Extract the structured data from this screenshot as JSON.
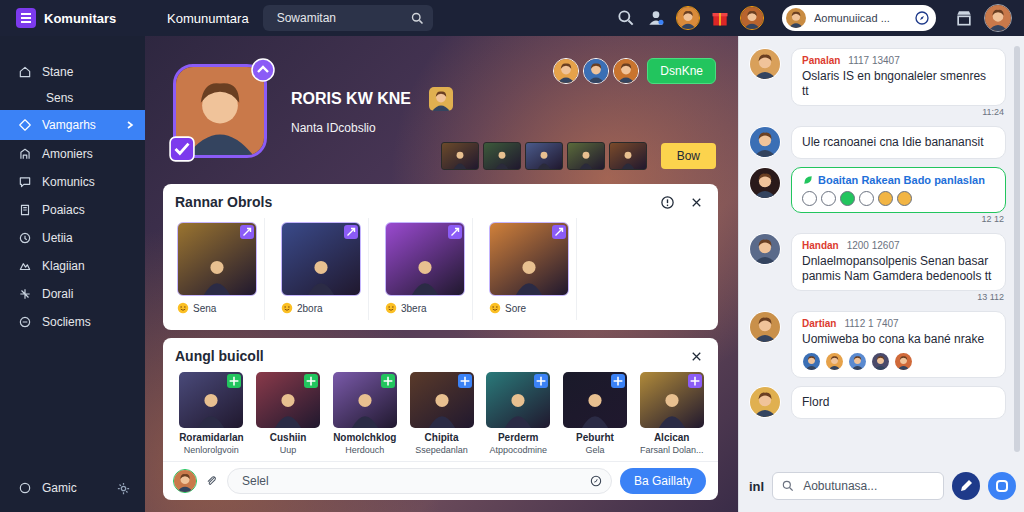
{
  "app": {
    "name": "Komunitars"
  },
  "topbar": {
    "title": "Komunumtara",
    "search": {
      "placeholder": "Sowamitan"
    },
    "community_search": {
      "placeholder": "Aomunuiicad ..."
    },
    "avatars": [
      {
        "color": "#d98a3a"
      },
      {
        "color": "#b8642e"
      },
      {
        "color": "#c98c42"
      }
    ]
  },
  "sidebar": {
    "items": [
      {
        "label": "Stane",
        "kind": "item",
        "selected": false
      },
      {
        "label": "Sens",
        "kind": "sub",
        "selected": false
      },
      {
        "label": "Vamgarhs",
        "kind": "item",
        "selected": true
      },
      {
        "label": "Amoniers",
        "kind": "item",
        "selected": false
      },
      {
        "label": "Komunics",
        "kind": "item",
        "selected": false
      },
      {
        "label": "Poaiacs",
        "kind": "item",
        "selected": false
      },
      {
        "label": "Uetiia",
        "kind": "item",
        "selected": false
      },
      {
        "label": "Klagiian",
        "kind": "item",
        "selected": false
      },
      {
        "label": "Dorali",
        "kind": "item",
        "selected": false
      },
      {
        "label": "Socliems",
        "kind": "item",
        "selected": false
      }
    ],
    "footer": {
      "label": "Gamic"
    }
  },
  "profile": {
    "name": "RORIS KW KNE",
    "subtitle": "Nanta IDcobslio",
    "verified": true,
    "avatar_color": "#c9794a",
    "mini_avatar_color": "#e0b050",
    "followers": [
      {
        "color": "#e6a24a"
      },
      {
        "color": "#3b6fb5"
      },
      {
        "color": "#c9742e"
      }
    ],
    "primary_button": "DsnKne",
    "games": [
      {
        "color": "#6b4a2a"
      },
      {
        "color": "#3c5a3a"
      },
      {
        "color": "#4a5a8a"
      },
      {
        "color": "#5a6a3a"
      },
      {
        "color": "#7a4a2a"
      }
    ],
    "secondary_button": "Bow"
  },
  "featured": {
    "title": "Rannar Obrols",
    "items": [
      {
        "label": "Sena",
        "image_color": "#9a7430",
        "color": "#8b5cf6"
      },
      {
        "label": "2bora",
        "image_color": "#3a4a8a",
        "color": "#8b5cf6"
      },
      {
        "label": "3bera",
        "image_color": "#9a4ad0",
        "color": "#8b5cf6"
      },
      {
        "label": "Sore",
        "image_color": "#d0803a",
        "color": "#8b5cf6"
      }
    ]
  },
  "collection": {
    "title": "Aungl buicoll",
    "items": [
      {
        "name": "Roramidarlan",
        "sub": "Nenlorolgvoin",
        "image_color": "#4a4a7a",
        "color": "#22c55e"
      },
      {
        "name": "Cushiin",
        "sub": "Uup",
        "image_color": "#8a3a4a",
        "color": "#22c55e"
      },
      {
        "name": "Nomolchklog",
        "sub": "Herdouch",
        "image_color": "#7a5aaa",
        "color": "#22c55e"
      },
      {
        "name": "Chipita",
        "sub": "Ssepedanlan",
        "image_color": "#5a3a2a",
        "color": "#3b82f6"
      },
      {
        "name": "Perderm",
        "sub": "Atppocodmine",
        "image_color": "#2a7a7a",
        "color": "#3b82f6"
      },
      {
        "name": "Peburht",
        "sub": "Gela",
        "image_color": "#1a1a2a",
        "color": "#3b82f6"
      },
      {
        "name": "Alcican",
        "sub": "Farsanl Dolan...",
        "image_color": "#b08a3a",
        "color": "#8b5cf6"
      }
    ],
    "composer": {
      "placeholder": "Selel",
      "button": "Ba Gaillaty"
    }
  },
  "chat": {
    "messages": [
      {
        "kind": "text",
        "author": "Panalan",
        "time": "1117 13407",
        "text": "Oslaris IS en bngonaleler smenres tt",
        "stamp": "11:24",
        "avatar_color": "#d9a05a"
      },
      {
        "kind": "plain",
        "text": "Ule rcanoanei cna Idie bananansit",
        "avatar_color": "#3b6fb5"
      },
      {
        "kind": "card",
        "title": "Boaitan Rakean Bado panlaslan",
        "stamp": "12 12",
        "avatar_color": "#2a1a1a",
        "reactions": [
          {
            "color": "#ffffff"
          },
          {
            "color": "#ffffff"
          },
          {
            "color": "#22c55e"
          },
          {
            "color": "#ffffff"
          },
          {
            "color": "#f2b544"
          },
          {
            "color": "#f2b544"
          }
        ]
      },
      {
        "kind": "text",
        "author": "Handan",
        "time": "1200 12607",
        "text": "Dnlaelmopansolpenis Senan basar panmis Nam Gamdera bedenools tt",
        "stamp": "13 112",
        "avatar_color": "#5a6a8a"
      },
      {
        "kind": "text",
        "author": "Dartian",
        "time": "1112 1 7407",
        "text": "Uomiweba bo cona ka bané nrake",
        "avatar_color": "#c9904a",
        "reactions": [
          {
            "color": "#3b6fb5"
          },
          {
            "color": "#e6a24a"
          },
          {
            "color": "#5a8ad0"
          },
          {
            "color": "#4a4a6a"
          },
          {
            "color": "#d06a3a"
          }
        ]
      },
      {
        "kind": "plain",
        "text": "Flord",
        "avatar_color": "#e0b050"
      }
    ],
    "composer": {
      "label": "inl",
      "placeholder": "Aobutunasa..."
    }
  }
}
